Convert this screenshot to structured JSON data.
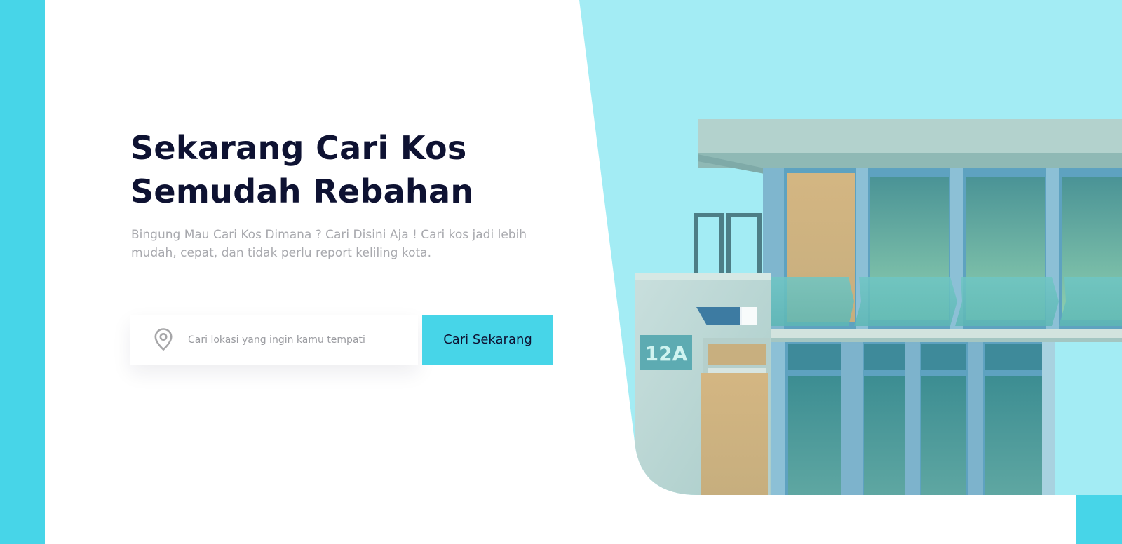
{
  "hero": {
    "title_line1": "Sekarang Cari Kos",
    "title_line2": "Semudah Rebahan",
    "subtitle": "Bingung Mau Cari Kos Dimana ? Cari Disini Aja ! Cari kos jadi lebih mudah, cepat, dan tidak perlu report keliling kota."
  },
  "search": {
    "placeholder": "Cari lokasi yang ingin kamu tempati",
    "value": "",
    "icon": "location-pin-icon",
    "button_label": "Cari Sekarang"
  },
  "illustration": {
    "house_number": "12A"
  },
  "colors": {
    "accent": "#47D5E8",
    "sky": "#A3ECF4",
    "title": "#0E1232",
    "subtitle": "#A8A9AE"
  }
}
